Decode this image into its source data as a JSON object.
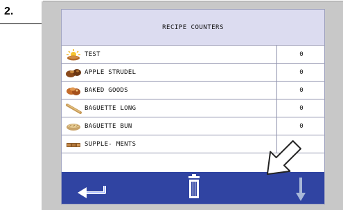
{
  "step": {
    "label": "2."
  },
  "screen": {
    "title": "RECIPE COUNTERS"
  },
  "recipes": [
    {
      "name": "TEST",
      "count": "0",
      "icon": "sun-bread-icon"
    },
    {
      "name": "APPLE STRUDEL",
      "count": "0",
      "icon": "apple-strudel-icon"
    },
    {
      "name": "BAKED GOODS",
      "count": "0",
      "icon": "baked-goods-icon"
    },
    {
      "name": "BAGUETTE LONG",
      "count": "0",
      "icon": "baguette-long-icon"
    },
    {
      "name": "BAGUETTE BUN",
      "count": "0",
      "icon": "baguette-bun-icon"
    },
    {
      "name": "SUPPLE- MENTS",
      "count": "",
      "icon": "supplements-icon"
    }
  ],
  "toolbar": {
    "back_icon": "back-arrow-icon",
    "delete_icon": "trash-icon",
    "down_icon": "down-arrow-icon"
  },
  "colors": {
    "header_bg": "#dcdcf0",
    "toolbar_bg": "#3044a2",
    "frame_bg": "#c8c8c8"
  }
}
